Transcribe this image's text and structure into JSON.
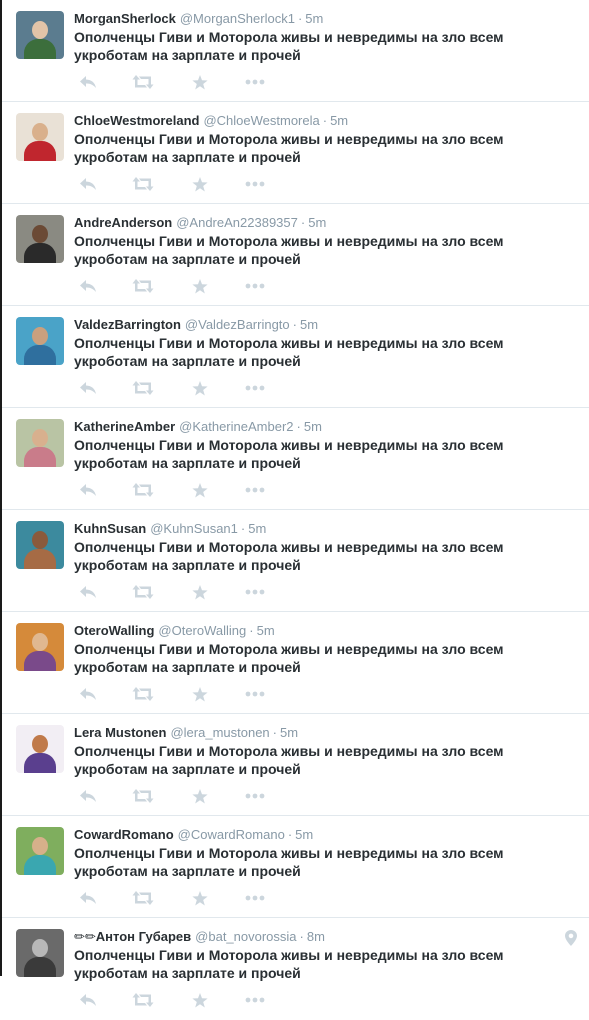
{
  "colors": {
    "name": "#292f33",
    "meta": "#8899a6",
    "icon": "#ccd6dd",
    "divider": "#e1e8ed"
  },
  "tweets": [
    {
      "fullname": "MorganSherlock",
      "username": "@MorganSherlock1",
      "sep": "·",
      "time": "5m",
      "text": "Ополченцы Гиви и Моторола живы и невредимы на зло всем укроботам на зарплате и прочей",
      "avatar": {
        "bg": "#5b7c8f",
        "head": "#e2c4a8",
        "body": "#3c6e3c"
      }
    },
    {
      "fullname": "ChloeWestmoreland",
      "username": "@ChloeWestmorela",
      "sep": "·",
      "time": "5m",
      "text": "Ополченцы Гиви и Моторола живы и невредимы на зло всем укроботам на зарплате и прочей",
      "avatar": {
        "bg": "#e9e1d6",
        "head": "#d9b08c",
        "body": "#c0262e"
      }
    },
    {
      "fullname": "AndreAnderson",
      "username": "@AndreAn22389357",
      "sep": "·",
      "time": "5m",
      "text": "Ополченцы Гиви и Моторола живы и невредимы на зло всем укроботам на зарплате и прочей",
      "avatar": {
        "bg": "#8a8a82",
        "head": "#6b4a35",
        "body": "#2a2a2a"
      }
    },
    {
      "fullname": "ValdezBarrington",
      "username": "@ValdezBarringto",
      "sep": "·",
      "time": "5m",
      "text": "Ополченцы Гиви и Моторола живы и невредимы на зло всем укроботам на зарплате и прочей",
      "avatar": {
        "bg": "#4aa3c8",
        "head": "#caa07e",
        "body": "#2f6f9e"
      }
    },
    {
      "fullname": "KatherineAmber",
      "username": "@KatherineAmber2",
      "sep": "·",
      "time": "5m",
      "text": "Ополченцы Гиви и Моторола живы и невредимы на зло всем укроботам на зарплате и прочей",
      "avatar": {
        "bg": "#b9c4a4",
        "head": "#d8b08e",
        "body": "#c97c8a"
      }
    },
    {
      "fullname": "KuhnSusan",
      "username": "@KuhnSusan1",
      "sep": "·",
      "time": "5m",
      "text": "Ополченцы Гиви и Моторола живы и невредимы на зло всем укроботам на зарплате и прочей",
      "avatar": {
        "bg": "#3c8a9e",
        "head": "#8a5a3c",
        "body": "#a66b45"
      }
    },
    {
      "fullname": "OteroWalling",
      "username": "@OteroWalling",
      "sep": "·",
      "time": "5m",
      "text": "Ополченцы Гиви и Моторола живы и невредимы на зло всем укроботам на зарплате и прочей",
      "avatar": {
        "bg": "#d58a3a",
        "head": "#e0b890",
        "body": "#7a4a8a"
      }
    },
    {
      "fullname": "Lera Mustonen",
      "username": "@lera_mustonen",
      "sep": "·",
      "time": "5m",
      "text": "Ополченцы Гиви и Моторола живы и невредимы на зло всем укроботам на зарплате и прочей",
      "avatar": {
        "bg": "#f2eef4",
        "head": "#c07a4a",
        "body": "#5a3f8e"
      }
    },
    {
      "fullname": "CowardRomano",
      "username": "@CowardRomano",
      "sep": "·",
      "time": "5m",
      "text": "Ополченцы Гиви и Моторола живы и невредимы на зло всем укроботам на зарплате и прочей",
      "avatar": {
        "bg": "#7fae5e",
        "head": "#d6b08a",
        "body": "#3aa7b0"
      }
    },
    {
      "fullname": "✏✏Антон Губарев",
      "username": "@bat_novorossia",
      "sep": "·",
      "time": "8m",
      "text": "Ополченцы Гиви и Моторола живы и невредимы на зло всем укроботам на зарплате и прочей",
      "avatar": {
        "bg": "#6a6a6a",
        "head": "#b8b8b8",
        "body": "#3a3a3a"
      },
      "geo": "map-pin-icon"
    }
  ]
}
